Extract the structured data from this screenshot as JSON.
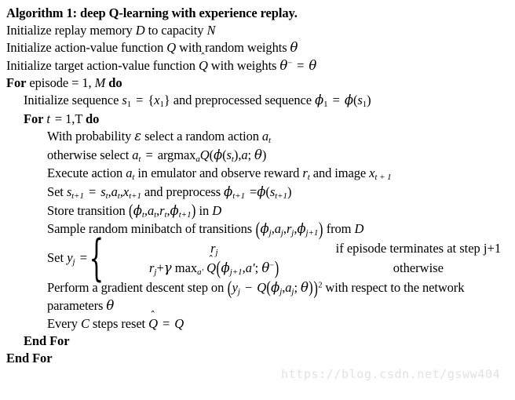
{
  "document": {
    "type": "algorithm-pseudocode",
    "background_color": "#ffffff",
    "text_color": "#000000",
    "title": "Algorithm 1: deep Q-learning with experience replay.",
    "watermark": "https://blog.csdn.net/gsww404",
    "watermark_color": "#e2e2e2"
  },
  "lines": {
    "l1": {
      "indent": 0,
      "text_plain": "Initialize replay memory D to capacity N",
      "seg_a": "Initialize replay memory ",
      "var_d": "D",
      "seg_b": " to capacity ",
      "var_n": "N"
    },
    "l2": {
      "indent": 0,
      "text_plain": "Initialize action-value function Q with random weights θ",
      "seg_a": "Initialize action-value function ",
      "var_q": "Q",
      "seg_b": " with random weights ",
      "var_theta": "θ"
    },
    "l3": {
      "indent": 0,
      "text_plain": "Initialize target action-value function Q̂ with weights θ⁻ = θ",
      "seg_a": "Initialize target action-value function ",
      "var_qhat": "Q",
      "seg_b": " with weights ",
      "var_theta": "θ",
      "sup_minus": "−",
      "eq": "=",
      "var_theta2": "θ"
    },
    "l4": {
      "indent": 0,
      "kw_for": "For",
      "seg_a": " episode ",
      "eq": "=",
      "seg_b": " 1, ",
      "var_m": "M",
      "kw_do": "do"
    },
    "l5": {
      "indent": 1,
      "seg_a": "Initialize sequence ",
      "var_s": "s",
      "sub_1": "1",
      "eq1": "=",
      "brace_open": "{",
      "var_x": "x",
      "sub_x1": "1",
      "brace_close": "}",
      "seg_b": " and preprocessed sequence ",
      "var_phi": "ϕ",
      "sub_phi1": "1",
      "eq2": "=",
      "var_phi2": "ϕ",
      "paren_open": "(",
      "var_s2": "s",
      "sub_s1": "1",
      "paren_close": ")"
    },
    "l6": {
      "indent": 1,
      "kw_for": "For",
      "var_t": "t",
      "eq": "=",
      "seg_a": " 1,T ",
      "kw_do": "do"
    },
    "l7": {
      "indent": 2,
      "seg_a": "With probability ",
      "var_eps": "ε",
      "seg_b": " select a random action ",
      "var_a": "a",
      "sub_t": "t"
    },
    "l8": {
      "indent": 2,
      "seg_a": "otherwise select ",
      "var_a": "a",
      "sub_t": "t",
      "eq": "=",
      "op_argmax": "argmax",
      "sub_a": "a",
      "var_q": "Q",
      "paren_open": "(",
      "var_phi": "ϕ",
      "paren2_open": "(",
      "var_s": "s",
      "sub_st": "t",
      "paren2_close": ")",
      "comma": ",",
      "var_a2": "a",
      "semi": "; ",
      "var_theta": "θ",
      "paren_close": ")"
    },
    "l9": {
      "indent": 2,
      "seg_a": "Execute action ",
      "var_a": "a",
      "sub_t": "t",
      "seg_b": " in emulator and observe reward ",
      "var_r": "r",
      "sub_rt": "t",
      "seg_c": " and image ",
      "var_x": "x",
      "sub_xt1": "t + 1"
    },
    "l10": {
      "indent": 2,
      "seg_a": "Set ",
      "var_s": "s",
      "sub_st1": "t+1",
      "eq1": "=",
      "var_s2": "s",
      "sub_t": "t",
      "c1": ",",
      "var_a": "a",
      "sub_at": "t",
      "c2": ",",
      "var_x": "x",
      "sub_xt1": "t+1",
      "seg_b": " and preprocess ",
      "var_phi": "ϕ",
      "sub_pt1": "t+1",
      "eq2": "=",
      "var_phi2": "ϕ",
      "paren_open": "(",
      "var_s3": "s",
      "sub_st1b": "t+1",
      "paren_close": ")"
    },
    "l11": {
      "indent": 2,
      "seg_a": "Store transition ",
      "paren_open": "(",
      "var_phi": "ϕ",
      "sub_t": "t",
      "c1": ",",
      "var_a": "a",
      "sub_at": "t",
      "c2": ",",
      "var_r": "r",
      "sub_rt": "t",
      "c3": ",",
      "var_phi2": "ϕ",
      "sub_pt1": "t+1",
      "paren_close": ")",
      "seg_b": " in ",
      "var_d": "D"
    },
    "l12": {
      "indent": 2,
      "seg_a": "Sample random minibatch of transitions ",
      "paren_open": "(",
      "var_phi": "ϕ",
      "sub_j": "j",
      "c1": ",",
      "var_a": "a",
      "sub_aj": "j",
      "c2": ",",
      "var_r": "r",
      "sub_rj": "j",
      "c3": ",",
      "var_phi2": "ϕ",
      "sub_pj1": "j+1",
      "paren_close": ")",
      "seg_b": " from ",
      "var_d": "D"
    },
    "l13_cases": {
      "indent": 2,
      "label_set": "Set ",
      "var_y": "y",
      "sub_j": "j",
      "eq": "=",
      "brace": "{",
      "case1_expr": {
        "var_r": "r",
        "sub_j": "j"
      },
      "case1_cond": "if episode terminates at step j+1",
      "case2_expr": {
        "var_r": "r",
        "sub_j": "j",
        "plus": "+",
        "var_gamma": "γ",
        "op_max": "max",
        "sub_ap": "a′",
        "var_qhat": "Q",
        "paren_open": "(",
        "var_phi": "ϕ",
        "sub_j1": "j+1",
        "c1": ",",
        "var_ap2": "a′",
        "semi": "; ",
        "var_theta": "θ",
        "sup_minus": "−",
        "paren_close": ")"
      },
      "case2_cond": "otherwise"
    },
    "l14": {
      "indent": 2,
      "seg_a": "Perform a gradient descent step on ",
      "paren_open": "(",
      "var_y": "y",
      "sub_j": "j",
      "minus": "−",
      "var_q": "Q",
      "paren2_open": "(",
      "var_phi": "ϕ",
      "sub_pj": "j",
      "c1": ",",
      "var_a": "a",
      "sub_aj": "j",
      "semi": "; ",
      "var_theta": "θ",
      "paren2_close": ")",
      "paren_close": ")",
      "sup_2": "2",
      "seg_b": " with respect to the network parameters ",
      "var_theta2": "θ"
    },
    "l15": {
      "indent": 2,
      "seg_a": "Every ",
      "var_c": "C",
      "seg_b": " steps reset ",
      "var_qhat": "Q",
      "eq": "=",
      "var_q": "Q"
    },
    "l16": {
      "indent": 1,
      "kw": "End For"
    },
    "l17": {
      "indent": 0,
      "kw": "End For"
    }
  }
}
